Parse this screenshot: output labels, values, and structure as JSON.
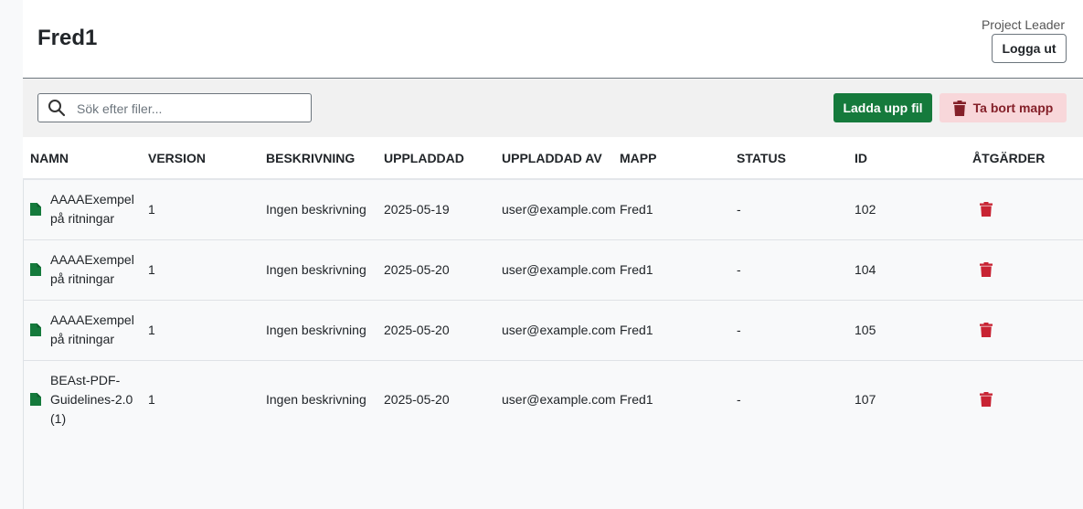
{
  "header": {
    "title": "Fred1",
    "role": "Project Leader",
    "logout_label": "Logga ut"
  },
  "toolbar": {
    "search_placeholder": "Sök efter filer...",
    "upload_label": "Ladda upp fil",
    "delete_folder_label": "Ta bort mapp"
  },
  "table": {
    "columns": [
      "NAMN",
      "VERSION",
      "BESKRIVNING",
      "UPPLADDAD",
      "UPPLADDAD AV",
      "MAPP",
      "STATUS",
      "ID",
      "ÅTGÄRDER"
    ],
    "rows": [
      {
        "name": "AAAAExempel på ritningar",
        "version": "1",
        "description": "Ingen beskrivning",
        "uploaded": "2025-05-19",
        "uploaded_by": "user@example.com",
        "folder": "Fred1",
        "status": "-",
        "id": "102"
      },
      {
        "name": "AAAAExempel på ritningar",
        "version": "1",
        "description": "Ingen beskrivning",
        "uploaded": "2025-05-20",
        "uploaded_by": "user@example.com",
        "folder": "Fred1",
        "status": "-",
        "id": "104"
      },
      {
        "name": "AAAAExempel på ritningar",
        "version": "1",
        "description": "Ingen beskrivning",
        "uploaded": "2025-05-20",
        "uploaded_by": "user@example.com",
        "folder": "Fred1",
        "status": "-",
        "id": "105"
      },
      {
        "name": "BEAst-PDF-Guidelines-2.0 (1)",
        "version": "1",
        "description": "Ingen beskrivning",
        "uploaded": "2025-05-20",
        "uploaded_by": "user@example.com",
        "folder": "Fred1",
        "status": "-",
        "id": "107"
      }
    ]
  },
  "colors": {
    "primary_green": "#157a3c",
    "danger_red": "#c82333",
    "danger_light": "#f8d7da"
  },
  "icons": {
    "search": "search-icon",
    "file": "file-icon",
    "trash": "trash-icon"
  }
}
